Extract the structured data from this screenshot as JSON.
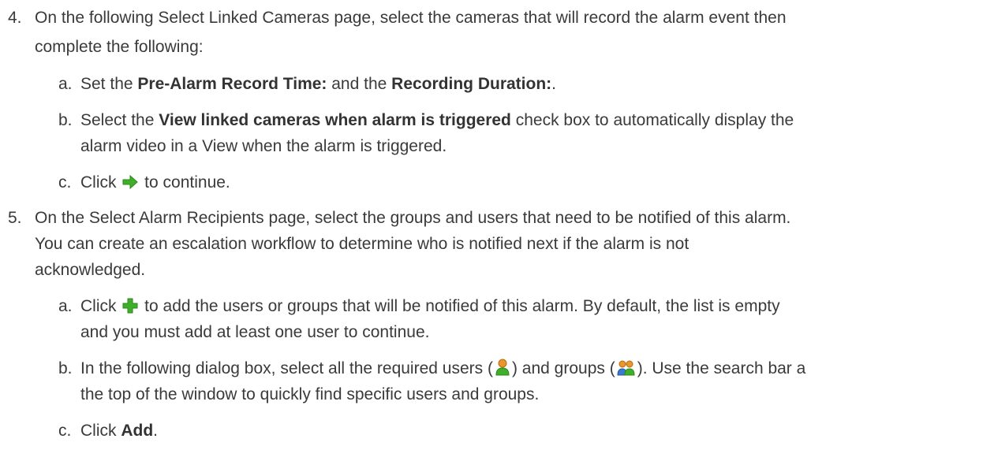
{
  "steps": [
    {
      "number": "4.",
      "lines": [
        "On the following Select Linked Cameras page, select the cameras that will record the alarm event then",
        "complete the following:"
      ],
      "substeps": [
        {
          "letter": "a.",
          "parts": {
            "t1": "Set the ",
            "b1": "Pre-Alarm Record Time:",
            "t2": " and the ",
            "b2": "Recording Duration:",
            "t3": "."
          }
        },
        {
          "letter": "b.",
          "parts": {
            "t1": "Select the ",
            "b1": "View linked cameras when alarm is triggered",
            "t2": " check box to automatically display the",
            "line2": "alarm video in a View when the alarm is triggered."
          }
        },
        {
          "letter": "c.",
          "parts": {
            "t1": "Click ",
            "icon": "green-right-arrow-icon",
            "t2": " to continue."
          }
        }
      ]
    },
    {
      "number": "5.",
      "lines": [
        "On the Select Alarm Recipients page, select the groups and users that need to be notified of this alarm.",
        "You can create an escalation workflow to determine who is notified next if the alarm is not",
        "acknowledged."
      ],
      "substeps": [
        {
          "letter": "a.",
          "parts": {
            "t1": "Click ",
            "icon": "green-plus-icon",
            "t2": " to add the users or groups that will be notified of this alarm. By default, the list is empty",
            "line2": "and you must add at least one user to continue."
          }
        },
        {
          "letter": "b.",
          "parts": {
            "t1": "In the following dialog box, select all the required users (",
            "icon1": "user-icon",
            "t2": ") and groups (",
            "icon2": "group-icon",
            "t3": "). Use the search bar a",
            "line2": "the top of the window to quickly find specific users and groups."
          }
        },
        {
          "letter": "c.",
          "parts": {
            "t1": "Click ",
            "b1": "Add",
            "t2": "."
          }
        }
      ]
    }
  ],
  "colors": {
    "text": "#3a3a3a",
    "icon_green": "#3fae2a",
    "user_orange": "#e8962e"
  }
}
